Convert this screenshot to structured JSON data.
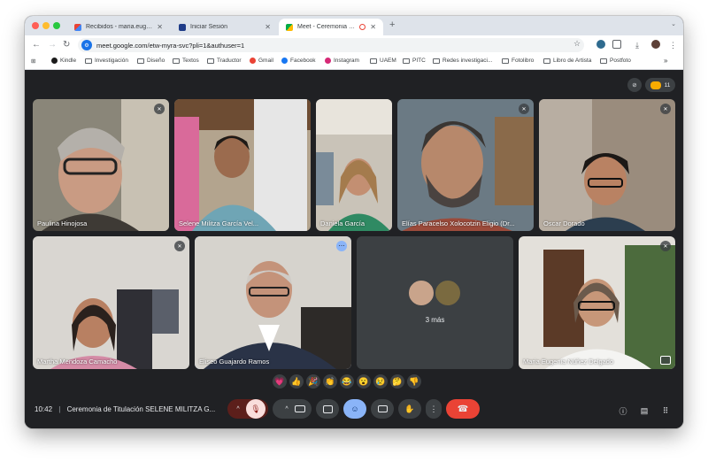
{
  "browser": {
    "tabs": [
      {
        "title": "Recibidos - maria.eugenia@uaem.mx",
        "active": false
      },
      {
        "title": "Iniciar Sesión",
        "active": false
      },
      {
        "title": "Meet - Ceremonia de Titulació",
        "active": true
      }
    ],
    "new_tab": "+",
    "url": "meet.google.com/etw-myra-svc?pli=1&authuser=1",
    "bookmarks": [
      "Kindle",
      "Investigación",
      "Diseño",
      "Textos",
      "Traductor",
      "Gmail",
      "Facebook",
      "Instagram",
      "UAEM",
      "PITC",
      "Redes investigaci...",
      "Fotolibro",
      "Libro de Artista",
      "Postfoto"
    ],
    "bookmarks_more": "»",
    "colors": {
      "tabstrip": "#dee3ea",
      "toolbar": "#ffffff",
      "accent": "#1a73e8"
    }
  },
  "meet": {
    "participant_count": "11",
    "participants": [
      {
        "name": "Paulina Hinojosa",
        "muted": true
      },
      {
        "name": "Selene Militza García Vel..."
      },
      {
        "name": "Daniela García"
      },
      {
        "name": "Elías Paracelso Xolocotzin Eligio (Dr...",
        "muted": true
      },
      {
        "name": "Oscar Dorado",
        "muted": true
      },
      {
        "name": "Martha Mendoza Camacho",
        "muted": true
      },
      {
        "name": "Eliseo Guajardo Ramos",
        "speaking": true
      },
      {
        "name": "Maria Eugenia Núñez Delgado",
        "muted": true
      }
    ],
    "more_tile_label": "3 más",
    "reactions": [
      "💗",
      "👍",
      "🎉",
      "👏",
      "😂",
      "😮",
      "😢",
      "🤔",
      "👎"
    ],
    "time": "10:42",
    "separator": "|",
    "meeting_title": "Ceremonia de Titulación SELENE MILITZA G...",
    "controls": {
      "mic_muted": true,
      "hangup_color": "#ea4335",
      "active_color": "#8ab4f8"
    },
    "colors": {
      "background": "#202124",
      "tile": "#3c4043",
      "speaking": "#8ab4f8"
    }
  }
}
